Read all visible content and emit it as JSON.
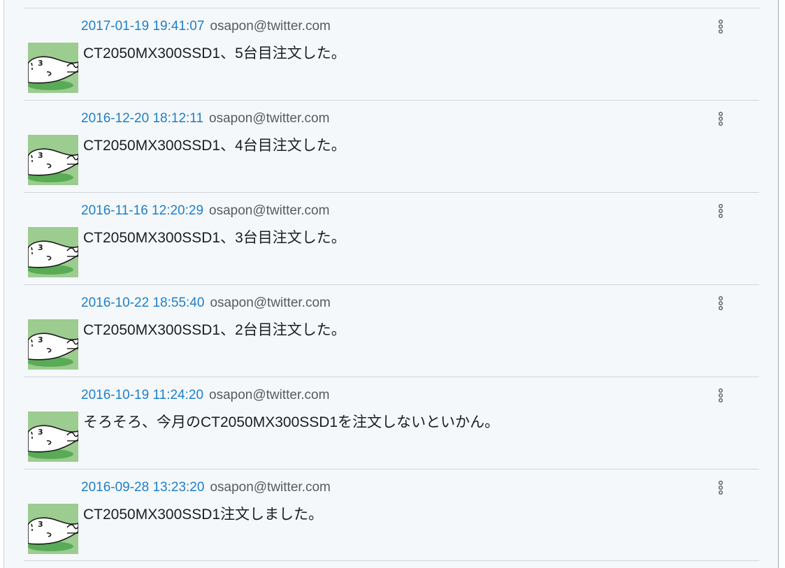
{
  "feed": {
    "posts": [
      {
        "timestamp": "2017-01-19 19:41:07",
        "author": "osapon@twitter.com",
        "text": "CT2050MX300SSD1、5台目注文した。"
      },
      {
        "timestamp": "2016-12-20 18:12:11",
        "author": "osapon@twitter.com",
        "text": "CT2050MX300SSD1、4台目注文した。"
      },
      {
        "timestamp": "2016-11-16 12:20:29",
        "author": "osapon@twitter.com",
        "text": "CT2050MX300SSD1、3台目注文した。"
      },
      {
        "timestamp": "2016-10-22 18:55:40",
        "author": "osapon@twitter.com",
        "text": "CT2050MX300SSD1、2台目注文した。"
      },
      {
        "timestamp": "2016-10-19 11:24:20",
        "author": "osapon@twitter.com",
        "text": "そろそろ、今月のCT2050MX300SSD1を注文しないといかん。"
      },
      {
        "timestamp": "2016-09-28 13:23:20",
        "author": "osapon@twitter.com",
        "text": "CT2050MX300SSD1注文しました。"
      }
    ]
  },
  "colors": {
    "timestamp_link": "#1e7fc8",
    "author": "#555b61",
    "panel_background": "#f5f8fa",
    "avatar_background": "#9ccc8f"
  },
  "icons": {
    "avatar": "seal-face-avatar-icon",
    "menu": "vertical-dots-menu-icon"
  }
}
